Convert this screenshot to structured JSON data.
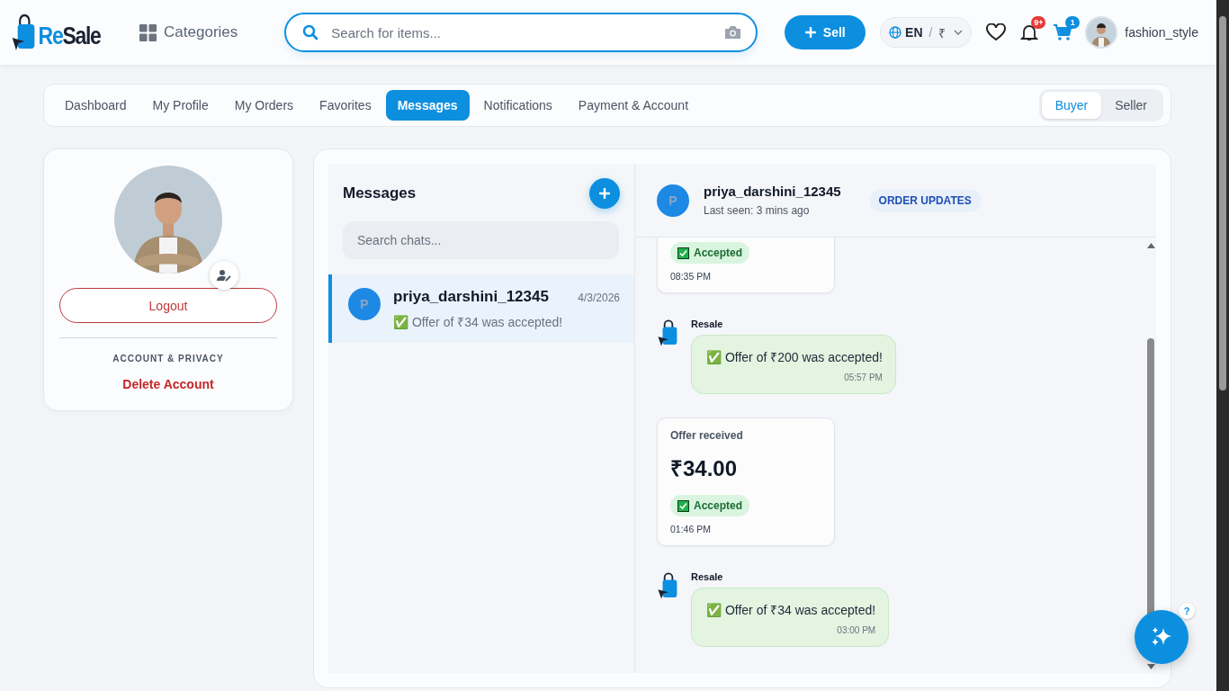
{
  "header": {
    "logo_part_1": "Re",
    "logo_part_2": "Sale",
    "categories": "Categories",
    "search": {
      "placeholder": "Search for items..."
    },
    "sell": "Sell",
    "language": "EN",
    "separator": "/",
    "currency": "₹",
    "notification_count": "9+",
    "cart_count": "1",
    "username": "fashion_style"
  },
  "tabs": [
    {
      "label": "Dashboard",
      "selected": false
    },
    {
      "label": "My Profile",
      "selected": false
    },
    {
      "label": "My Orders",
      "selected": false
    },
    {
      "label": "Favorites",
      "selected": false
    },
    {
      "label": "Messages",
      "selected": true
    },
    {
      "label": "Notifications",
      "selected": false
    },
    {
      "label": "Payment & Account",
      "selected": false
    }
  ],
  "roles": [
    {
      "label": "Buyer",
      "selected": true
    },
    {
      "label": "Seller",
      "selected": false
    }
  ],
  "profile": {
    "logout": "Logout",
    "section": "ACCOUNT & PRIVACY",
    "delete": "Delete Account"
  },
  "chats": {
    "title": "Messages",
    "search": {
      "placeholder": "Search chats..."
    },
    "items": [
      {
        "avatar": "P",
        "name": "priya_darshini_12345",
        "date": "4/3/2026",
        "preview": "✅ Offer of ₹34 was accepted!",
        "selected": true
      }
    ]
  },
  "conversation": {
    "avatar": "P",
    "name": "priya_darshini_12345",
    "status": "Last seen: 3 mins ago",
    "tag": "ORDER UPDATES",
    "messages": [
      {
        "kind": "offer",
        "status": "Accepted",
        "time": "08:35 PM"
      },
      {
        "kind": "system",
        "sender": "Resale",
        "text": "✅ Offer of ₹200 was accepted!",
        "time": "05:57 PM"
      },
      {
        "kind": "offer",
        "label": "Offer received",
        "amount": "₹34.00",
        "status": "Accepted",
        "time": "01:46 PM"
      },
      {
        "kind": "system",
        "sender": "Resale",
        "text": "✅ Offer of ₹34 was accepted!",
        "time": "03:00 PM"
      }
    ]
  },
  "help": "?"
}
